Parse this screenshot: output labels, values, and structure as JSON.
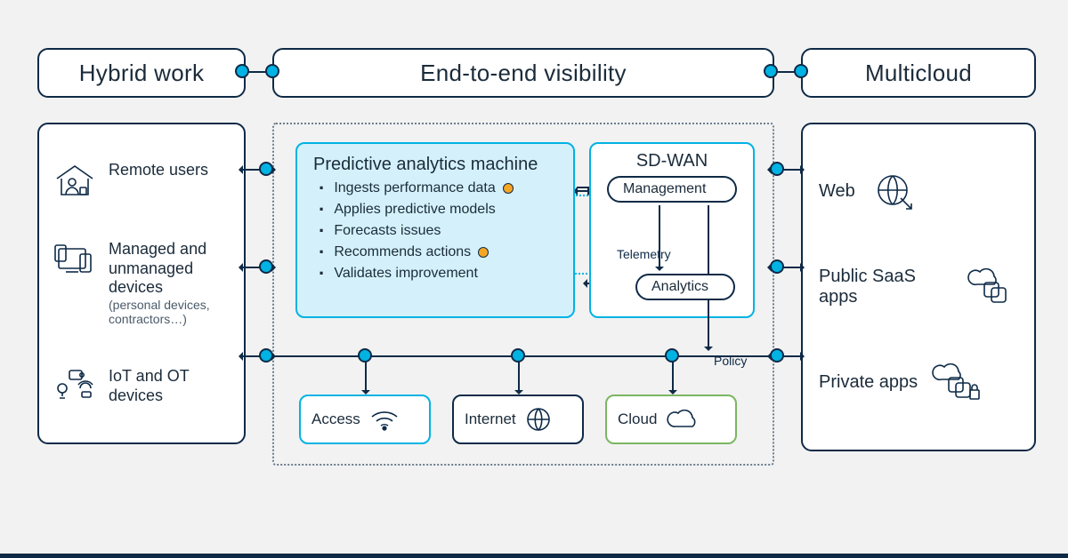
{
  "header": {
    "left": "Hybrid work",
    "mid": "End-to-end visibility",
    "right": "Multicloud"
  },
  "left_panel": {
    "row1": "Remote users",
    "row2": "Managed and unmanaged devices",
    "row2_sub": "(personal devices, contractors…)",
    "row3": "IoT and OT devices"
  },
  "right_panel": {
    "row1": "Web",
    "row2": "Public SaaS apps",
    "row3": "Private apps"
  },
  "predictive": {
    "title": "Predictive analytics machine",
    "items": [
      "Ingests performance data",
      "Applies predictive models",
      "Forecasts issues",
      "Recommends actions",
      "Validates improvement"
    ]
  },
  "sdwan": {
    "title": "SD-WAN",
    "mgmt": "Management",
    "analytics": "Analytics",
    "telemetry": "Telemetry",
    "policy": "Policy"
  },
  "network": {
    "access": "Access",
    "internet": "Internet",
    "cloud": "Cloud"
  }
}
